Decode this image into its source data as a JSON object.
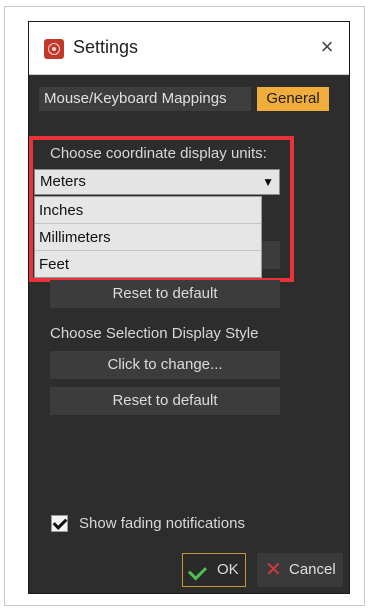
{
  "window": {
    "title": "Settings",
    "close_icon": "×"
  },
  "tabs": [
    {
      "label": "Mouse/Keyboard Mappings",
      "active": false
    },
    {
      "label": "General",
      "active": true
    }
  ],
  "coordinate_units": {
    "label": "Choose coordinate display units:",
    "selected": "Meters",
    "arrow": "⌄",
    "options": [
      "Inches",
      "Millimeters",
      "Feet"
    ],
    "reset_label": "Reset to default"
  },
  "selection_style": {
    "label": "Choose Selection Display Style",
    "change_label": "Click to change...",
    "reset_label": "Reset to default"
  },
  "notifications": {
    "label": "Show fading notifications",
    "checked": true
  },
  "footer": {
    "ok_label": "OK",
    "cancel_label": "Cancel"
  },
  "colors": {
    "accent": "#f0ad3c",
    "highlight": "#e8333b",
    "ok_check": "#4cc24c",
    "cancel_x": "#d23a3a"
  }
}
